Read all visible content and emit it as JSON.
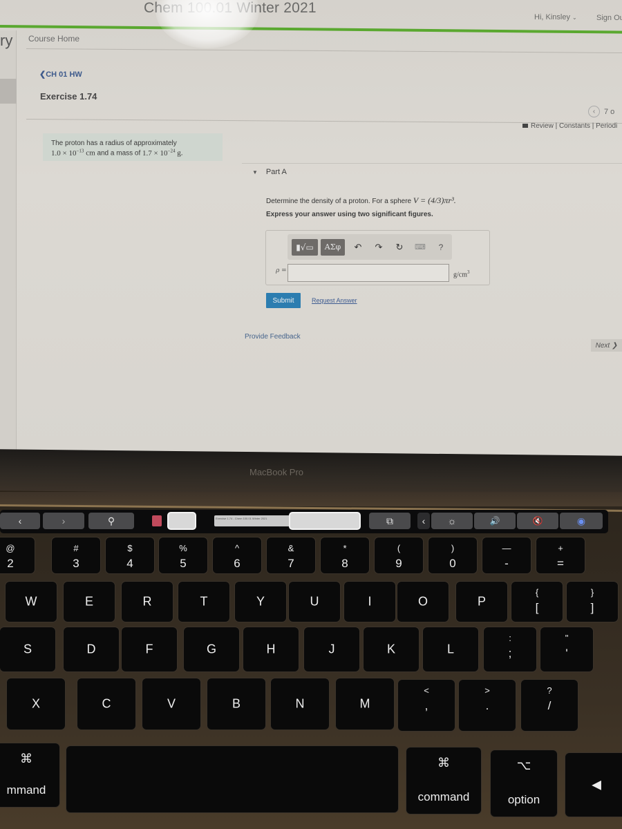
{
  "browser_page": {
    "course_title": "Chem 100.01 Winter 2021",
    "user_greeting": "Hi, Kinsley",
    "user_caret": "⌄",
    "sign_out": "Sign Ou",
    "left_rail_label": "ry",
    "nav": {
      "course_home": "Course Home",
      "back_link": "❮CH 01 HW",
      "exercise_title": "Exercise 1.74"
    },
    "pager": {
      "prev_icon": "‹",
      "count": "7 o"
    },
    "resources": "Review | Constants | Periodi",
    "problem": {
      "intro": "The proton has a radius of approximately",
      "radius_mantissa": "1.0 × 10",
      "radius_exp": "−13",
      "radius_unit": "cm",
      "mid_text": "and a mass of",
      "mass_mantissa": "1.7 × 10",
      "mass_exp": "−24",
      "mass_unit": "g."
    },
    "part": {
      "label": "Part A",
      "toggle_icon": "▼",
      "question_text": "Determine the density of a proton. For a sphere ",
      "formula": "V = (4/3)πr³.",
      "instruction": "Express your answer using two significant figures."
    },
    "answer_toolbar": {
      "template_button": "▮√▭",
      "greek_button": "ΑΣφ",
      "undo_icon": "↶",
      "redo_icon": "↷",
      "reset_icon": "↻",
      "keyboard_icon": "⌨",
      "help_icon": "?"
    },
    "answer": {
      "variable_label": "ρ =",
      "value": "",
      "unit": "g/cm",
      "unit_exp": "3"
    },
    "buttons": {
      "submit": "Submit",
      "request_answer": "Request Answer",
      "provide_feedback": "Provide Feedback",
      "next": "Next ❯"
    }
  },
  "device": {
    "brand": "MacBook Pro"
  },
  "touch_bar": {
    "back": "‹",
    "forward": "›",
    "search_icon": "⚲",
    "new_tab_icon": "⧉",
    "expand_icon": "‹",
    "brightness_icon": "☼",
    "volume_icon": "🔊",
    "mute_icon": "🔇",
    "siri_icon": "◉",
    "tab_preview_text": "Exercise 1.74 - Chem 100.01 Winter 2021"
  },
  "keyboard": {
    "number_row": [
      {
        "top": "@",
        "bottom": "2"
      },
      {
        "top": "#",
        "bottom": "3"
      },
      {
        "top": "$",
        "bottom": "4"
      },
      {
        "top": "%",
        "bottom": "5"
      },
      {
        "top": "^",
        "bottom": "6"
      },
      {
        "top": "&",
        "bottom": "7"
      },
      {
        "top": "*",
        "bottom": "8"
      },
      {
        "top": "(",
        "bottom": "9"
      },
      {
        "top": ")",
        "bottom": "0"
      },
      {
        "top": "—",
        "bottom": "-"
      },
      {
        "top": "+",
        "bottom": "="
      }
    ],
    "top_row": [
      "W",
      "E",
      "R",
      "T",
      "Y",
      "U",
      "I",
      "O",
      "P"
    ],
    "top_row_symbols": [
      {
        "top": "{",
        "bottom": "["
      },
      {
        "top": "}",
        "bottom": "]"
      }
    ],
    "home_row": [
      "S",
      "D",
      "F",
      "G",
      "H",
      "J",
      "K",
      "L"
    ],
    "home_row_symbols": [
      {
        "top": ":",
        "bottom": ";"
      },
      {
        "top": "\"",
        "bottom": "'"
      }
    ],
    "bottom_row": [
      "X",
      "C",
      "V",
      "B",
      "N",
      "M"
    ],
    "bottom_row_symbols": [
      {
        "top": "<",
        "bottom": ","
      },
      {
        "top": ">",
        "bottom": "."
      },
      {
        "top": "?",
        "bottom": "/"
      }
    ],
    "left_command": {
      "symbol": "⌘",
      "label": "mmand"
    },
    "right_command": {
      "symbol": "⌘",
      "label": "command"
    },
    "option": {
      "symbol": "⌥",
      "label": "option"
    },
    "arrow_left": "◀"
  }
}
